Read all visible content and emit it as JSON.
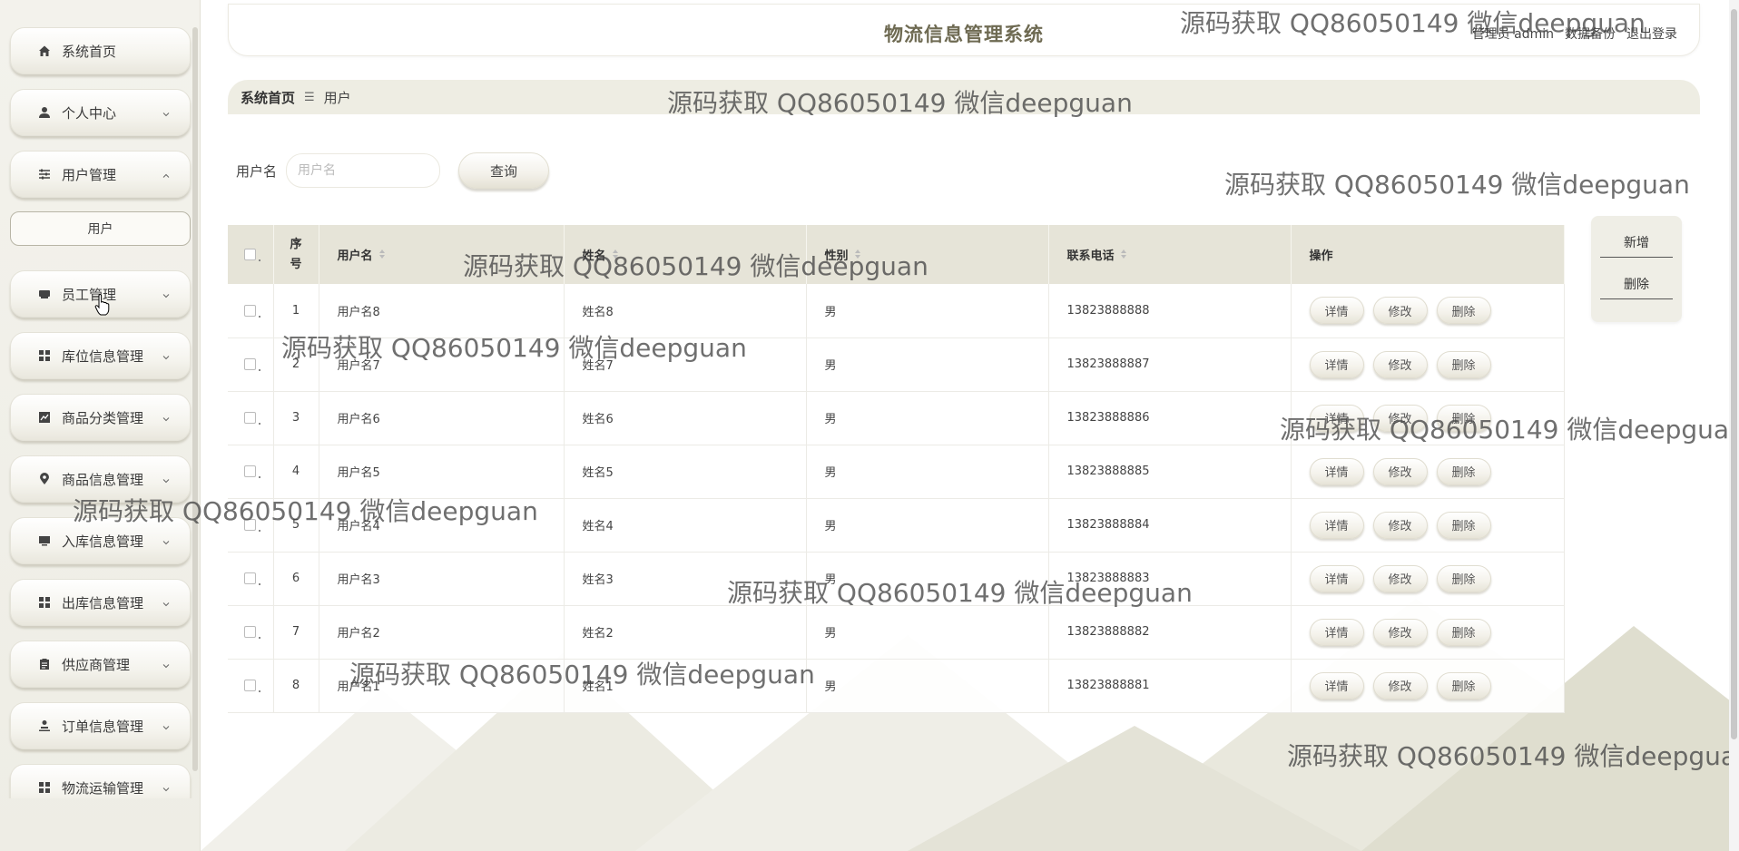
{
  "app": {
    "title": "物流信息管理系统",
    "header_links": [
      "管理员 admin",
      "数据备份",
      "退出登录"
    ]
  },
  "sidebar": {
    "items": [
      {
        "label": "系统首页",
        "icon": "home-icon",
        "has_chevron": false
      },
      {
        "label": "个人中心",
        "icon": "user-icon",
        "has_chevron": true
      },
      {
        "label": "用户管理",
        "icon": "sliders-icon",
        "has_chevron": true,
        "expanded": true
      },
      {
        "label": "员工管理",
        "icon": "idcard-icon",
        "has_chevron": true
      },
      {
        "label": "库位信息管理",
        "icon": "grid-icon",
        "has_chevron": true
      },
      {
        "label": "商品分类管理",
        "icon": "chart-icon",
        "has_chevron": true
      },
      {
        "label": "商品信息管理",
        "icon": "location-pin-icon",
        "has_chevron": true
      },
      {
        "label": "入库信息管理",
        "icon": "monitor-icon",
        "has_chevron": true
      },
      {
        "label": "出库信息管理",
        "icon": "grid-icon",
        "has_chevron": true
      },
      {
        "label": "供应商管理",
        "icon": "clipboard-icon",
        "has_chevron": true
      },
      {
        "label": "订单信息管理",
        "icon": "person-stand-icon",
        "has_chevron": true
      },
      {
        "label": "物流运输管理",
        "icon": "grid-icon",
        "has_chevron": true
      }
    ],
    "sub_item": "用户"
  },
  "breadcrumb": {
    "home": "系统首页",
    "separator": "☰",
    "current": "用户"
  },
  "search": {
    "label": "用户名",
    "placeholder": "用户名",
    "button": "查询"
  },
  "actions": {
    "add": "新增",
    "delete": "删除"
  },
  "table": {
    "headers": {
      "no": "序号",
      "username": "用户名",
      "name": "姓名",
      "gender": "性别",
      "phone": "联系电话",
      "ops": "操作"
    },
    "row_buttons": {
      "detail": "详情",
      "edit": "修改",
      "delete": "删除"
    },
    "rows": [
      {
        "no": "1",
        "username": "用户名8",
        "name": "姓名8",
        "gender": "男",
        "phone": "13823888888"
      },
      {
        "no": "2",
        "username": "用户名7",
        "name": "姓名7",
        "gender": "男",
        "phone": "13823888887"
      },
      {
        "no": "3",
        "username": "用户名6",
        "name": "姓名6",
        "gender": "男",
        "phone": "13823888886"
      },
      {
        "no": "4",
        "username": "用户名5",
        "name": "姓名5",
        "gender": "男",
        "phone": "13823888885"
      },
      {
        "no": "5",
        "username": "用户名4",
        "name": "姓名4",
        "gender": "男",
        "phone": "13823888884"
      },
      {
        "no": "6",
        "username": "用户名3",
        "name": "姓名3",
        "gender": "男",
        "phone": "13823888883"
      },
      {
        "no": "7",
        "username": "用户名2",
        "name": "姓名2",
        "gender": "男",
        "phone": "13823888882"
      },
      {
        "no": "8",
        "username": "用户名1",
        "name": "姓名1",
        "gender": "男",
        "phone": "13823888881"
      }
    ]
  },
  "watermark": "源码获取 QQ86050149 微信deepguan",
  "colors": {
    "accent": "#6e6a52",
    "sidebar_bg": "#f0efe8",
    "table_header": "#e6e4d8"
  }
}
